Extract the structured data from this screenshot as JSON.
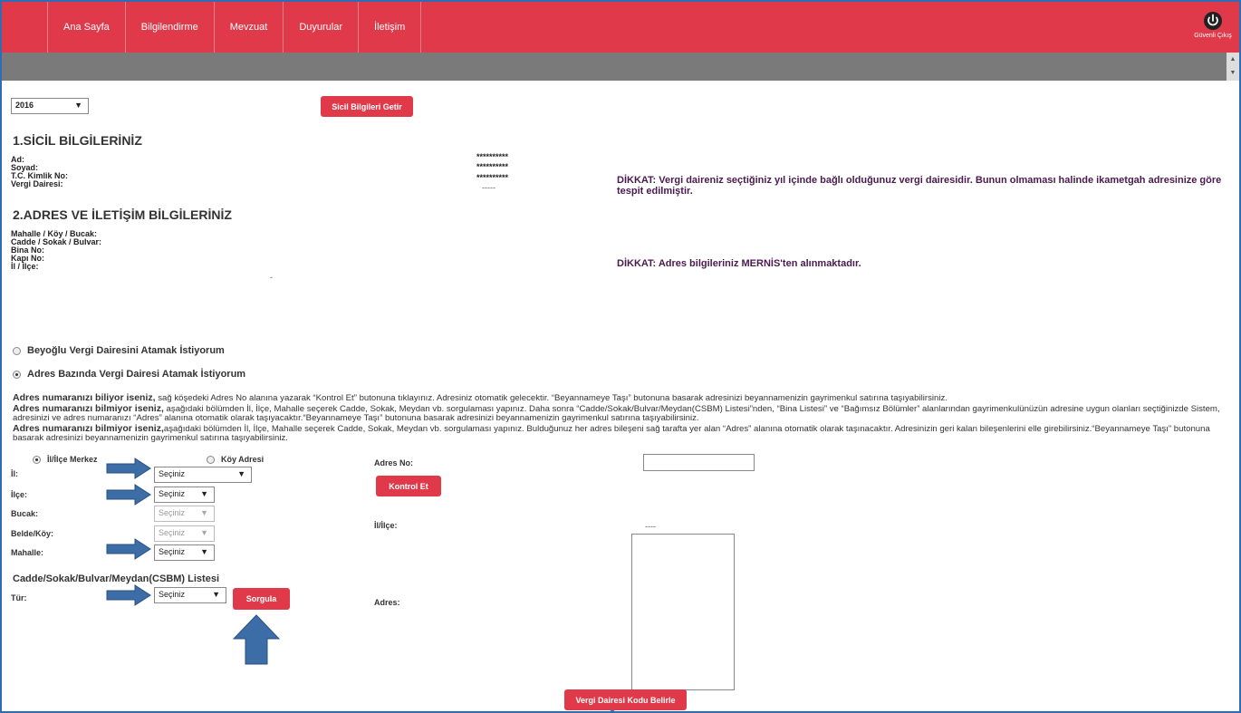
{
  "nav": {
    "items": [
      "Ana Sayfa",
      "Bilgilendirme",
      "Mevzuat",
      "Duyurular",
      "İletişim"
    ],
    "logout_label": "Güvenli Çıkış"
  },
  "year_select": {
    "value": "2016"
  },
  "buttons": {
    "sicil": "Sicil Bilgileri Getir",
    "kontrol": "Kontrol Et",
    "sorgula": "Sorgula",
    "vergi_kodu": "Vergi Dairesi Kodu Belirle"
  },
  "sicil": {
    "title": "1.SİCİL BİLGİLERİNİZ",
    "labels": [
      "Ad:",
      "Soyad:",
      "T.C. Kimlik No:",
      "Vergi Dairesi:"
    ],
    "values": [
      "**********",
      "**********",
      "**********",
      "-----"
    ],
    "notice": "DİKKAT: Vergi daireniz seçtiğiniz yıl içinde bağlı olduğunuz vergi dairesidir. Bunun olmaması halinde ikametgah adresinize göre tespit edilmiştir."
  },
  "adres": {
    "title": "2.ADRES VE İLETİŞİM BİLGİLERİNİZ",
    "labels": [
      "Mahalle / Köy / Bucak:",
      "Cadde / Sokak / Bulvar:",
      "Bina No:",
      "Kapı No:",
      "İl / İlçe:"
    ],
    "il_ilce_value": "-",
    "notice": "DİKKAT: Adres bilgileriniz MERNİS'ten alınmaktadır."
  },
  "options": {
    "beyoglu": "Beyoğlu Vergi Dairesini Atamak İstiyorum",
    "adres_bazinda": "Adres Bazında Vergi Dairesi Atamak İstiyorum"
  },
  "info": {
    "p1_bold": "Adres numaranızı biliyor iseniz,",
    "p1": " sağ köşedeki Adres No alanına yazarak “Kontrol Et” butonuna tıklayınız. Adresiniz otomatik gelecektir. “Beyannameye Taşı” butonuna basarak adresinizi beyannamenizin gayrimenkul satırına taşıyabilirsiniz.",
    "p2_bold": "Adres numaranızı bilmiyor iseniz,",
    "p2": " aşağıdaki bölümden İl, İlçe, Mahalle seçerek Cadde, Sokak, Meydan vb. sorgulaması yapınız. Daha sonra “Cadde/Sokak/Bulvar/Meydan(CSBM) Listesi”nden, “Bina Listesi” ve “Bağımsız Bölümler” alanlarından gayrimenkulünüzün adresine uygun olanları seçtiğinizde Sistem, adresinizi ve adres numaranızı “Adres” alanına otomatik olarak taşıyacaktır.“Beyannameye Taşı” butonuna basarak adresinizi beyannamenizin gayrimenkul satırına taşıyabilirsiniz.",
    "p3_bold": "Adres numaranızı bilmiyor iseniz,",
    "p3": "aşağıdaki bölümden İl, İlçe, Mahalle seçerek Cadde, Sokak, Meydan vb. sorgulaması yapınız. Bulduğunuz her adres bileşeni sağ tarafta yer alan “Adres” alanına otomatik olarak taşınacaktır. Adresinizin geri kalan bileşenlerini elle girebilirsiniz.“Beyannameye Taşı” butonuna basarak adresinizi beyannamenizin gayrimenkul satırına taşıyabilirsiniz."
  },
  "form": {
    "radio_merkez": "İl/İlçe Merkez",
    "radio_koy": "Köy Adresi",
    "il_label": "İl:",
    "ilce_label": "İlçe:",
    "bucak_label": "Bucak:",
    "belde_label": "Belde/Köy:",
    "mahalle_label": "Mahalle:",
    "select_placeholder": "Seçiniz",
    "csbm_title": "Cadde/Sokak/Bulvar/Meydan(CSBM) Listesi",
    "tur_label": "Tür:",
    "adres_no_label": "Adres No:",
    "il_ilce_label": "İl/İlçe:",
    "il_ilce_value": "----",
    "adres_label": "Adres:"
  },
  "colors": {
    "primary": "#e03a4a",
    "arrow": "#3d6da6",
    "graybar": "#7a7a7a"
  }
}
